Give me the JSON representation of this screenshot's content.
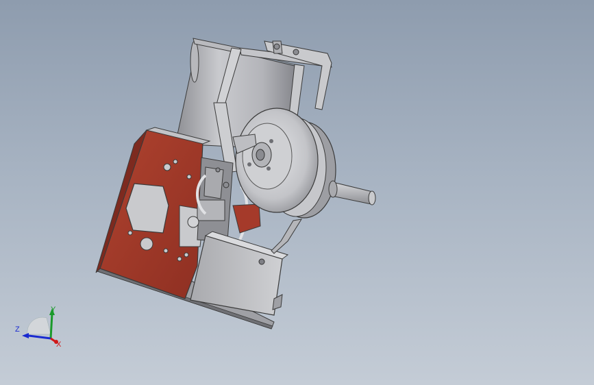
{
  "viewport": {
    "background_top": "#8e9cae",
    "background_bottom": "#c4ccd6"
  },
  "model": {
    "body_color": "#c7c8cc",
    "plate_color": "#a53a2a",
    "edge_color": "#3a3a3a"
  },
  "triad": {
    "x_label": "X",
    "y_label": "Y",
    "z_label": "Z",
    "x_color": "#d01818",
    "y_color": "#1a9a2a",
    "z_color": "#1a2ad0"
  }
}
